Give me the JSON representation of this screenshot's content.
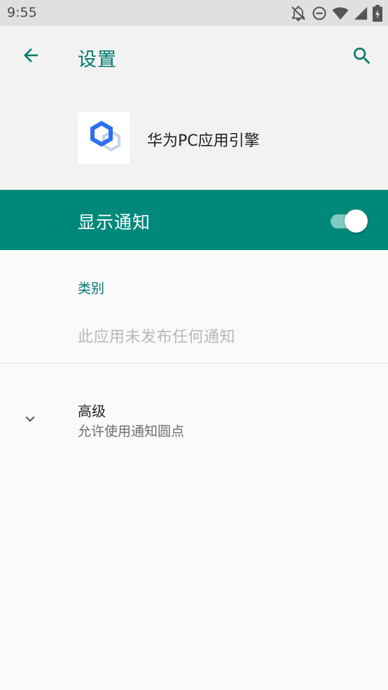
{
  "status_bar": {
    "time": "9:55",
    "icons": [
      "notifications-off-icon",
      "do-not-disturb-icon",
      "wifi-icon",
      "cell-signal-icon",
      "battery-charging-icon"
    ]
  },
  "header": {
    "title": "设置",
    "back_icon": "arrow-back-icon",
    "search_icon": "search-icon"
  },
  "app": {
    "name": "华为PC应用引擎",
    "icon": "hexagon-logo-icon"
  },
  "show_notifications": {
    "label": "显示通知",
    "enabled": true
  },
  "categories": {
    "header": "类别",
    "empty_text": "此应用未发布任何通知"
  },
  "advanced": {
    "title": "高级",
    "subtitle": "允许使用通知圆点",
    "icon": "chevron-down-icon"
  },
  "colors": {
    "accent": "#00796b",
    "bar": "#00897b",
    "status_bar": "#e0e0e0",
    "header_bg": "#f2f2f2",
    "background": "#fafafa",
    "logo_blue": "#2e6ff2"
  }
}
